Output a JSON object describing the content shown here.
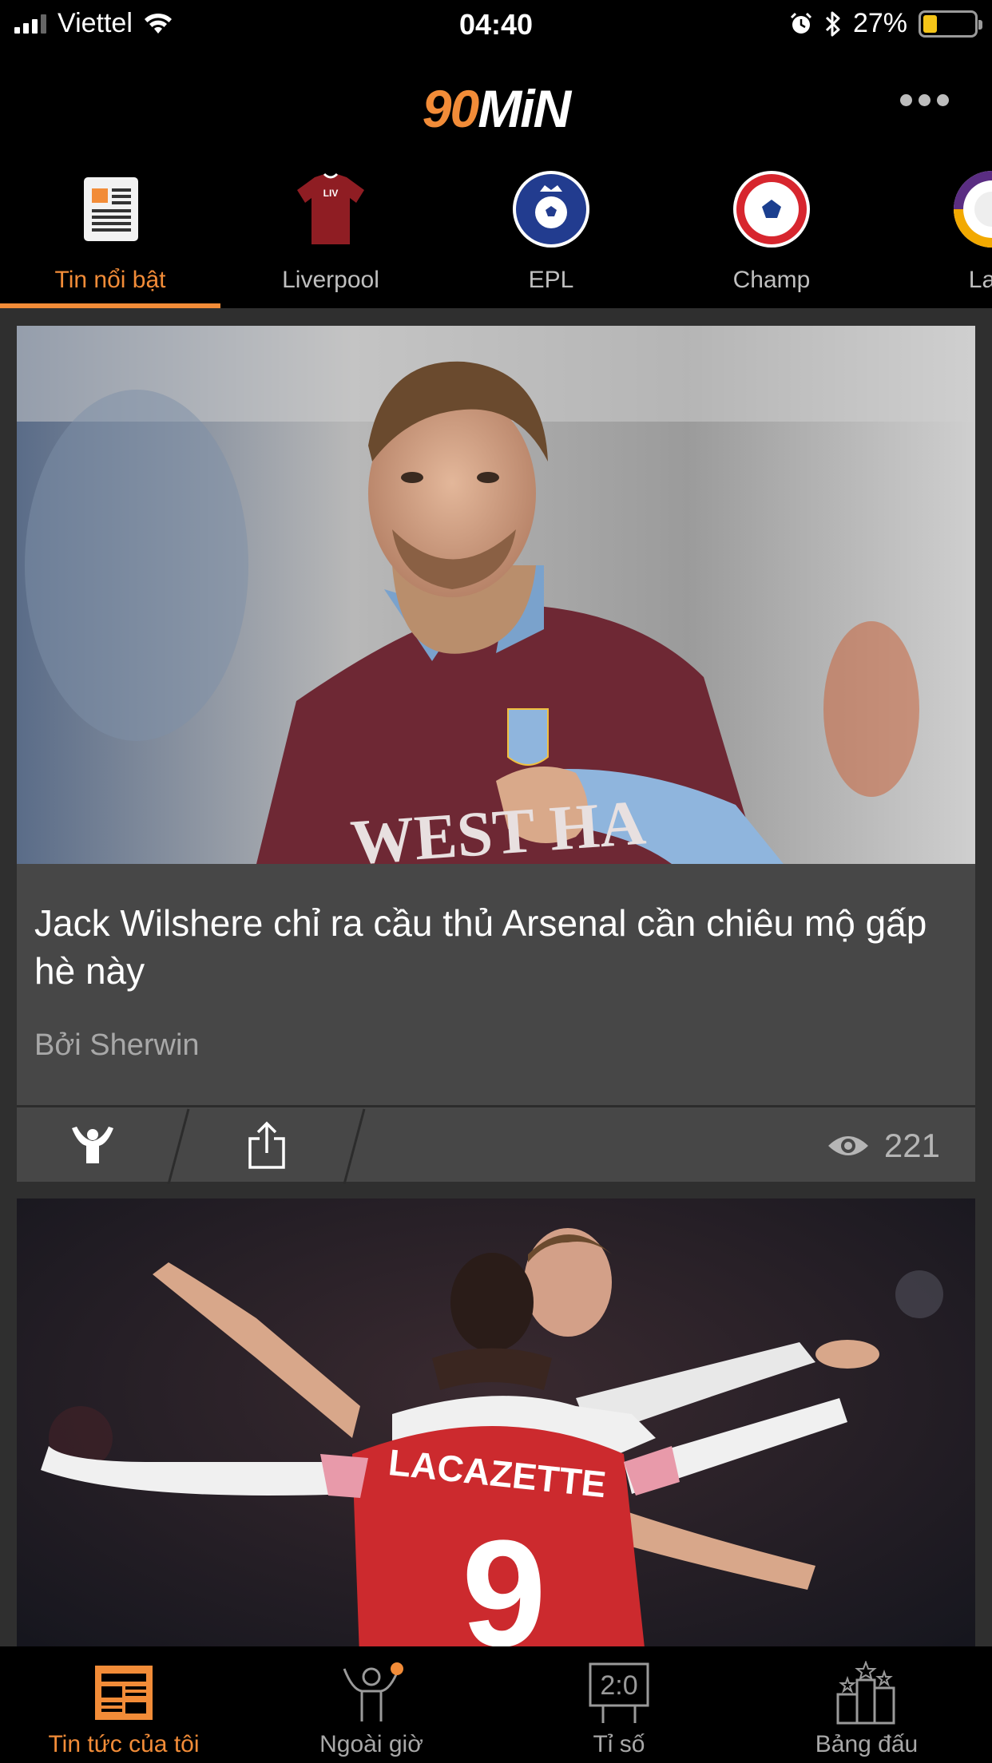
{
  "status_bar": {
    "carrier": "Viettel",
    "time": "04:40",
    "battery_percent": "27%",
    "battery_level": 0.27
  },
  "header": {
    "logo_number": "90",
    "logo_text": "MiN",
    "more_icon": "more-horizontal-icon"
  },
  "categories": [
    {
      "label": "Tin nổi bật",
      "icon": "newspaper-icon",
      "active": true
    },
    {
      "label": "Liverpool",
      "icon": "liverpool-shirt-icon",
      "active": false
    },
    {
      "label": "EPL",
      "icon": "epl-ball-icon",
      "active": false
    },
    {
      "label": "Champ",
      "icon": "champions-ball-icon",
      "active": false
    },
    {
      "label": "La L",
      "icon": "laliga-ball-icon",
      "active": false
    }
  ],
  "articles": [
    {
      "title": "Jack Wilshere chỉ ra cầu thủ Arsenal cần chiêu mộ gấp hè này",
      "author": "Bởi Sherwin",
      "views": "221",
      "image": "west-ham-player-photo"
    },
    {
      "image": "arsenal-players-celebrating-photo"
    }
  ],
  "bottom_nav": [
    {
      "label": "Tin tức của tôi",
      "icon": "my-news-icon",
      "active": true
    },
    {
      "label": "Ngoài giờ",
      "icon": "cheer-person-icon",
      "active": false,
      "badge": true
    },
    {
      "label": "Tỉ số",
      "icon": "scoreboard-icon",
      "active": false,
      "score_text": "2:0"
    },
    {
      "label": "Bảng đấu",
      "icon": "standings-podium-icon",
      "active": false
    }
  ],
  "colors": {
    "accent": "#f28c38",
    "background": "#000000",
    "feed_background": "#2f2f2f",
    "card_background": "#474747"
  }
}
